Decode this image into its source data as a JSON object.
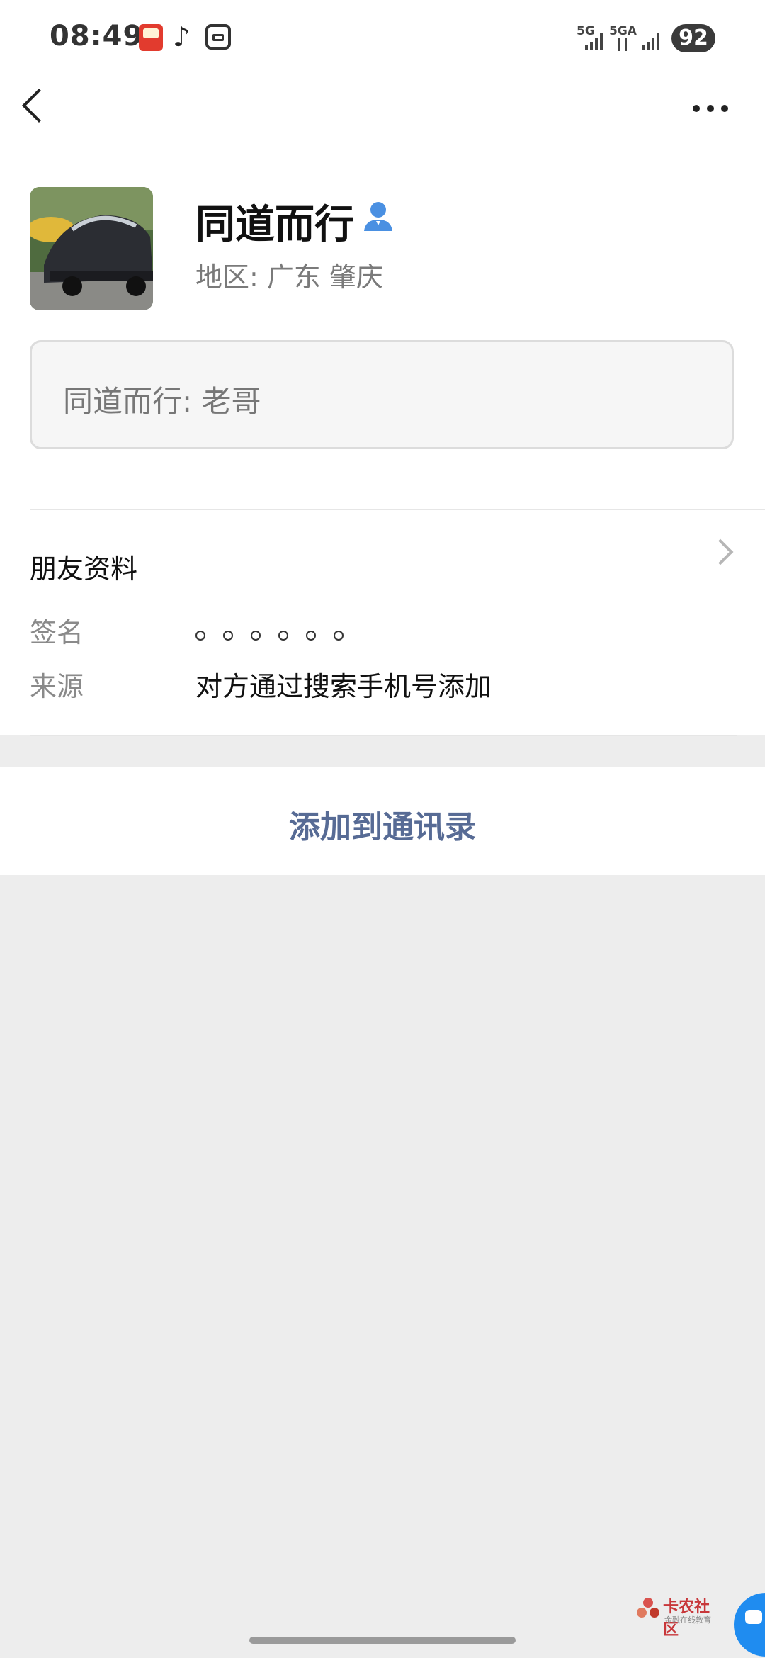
{
  "status_bar": {
    "time": "08:49",
    "net1": "5G",
    "net2": "5GA",
    "battery": "92",
    "icons": [
      "app-icon",
      "tiktok-icon",
      "screenshot-icon",
      "signal-icon",
      "signal-icon",
      "signal-icon",
      "battery-icon"
    ]
  },
  "nav": {
    "back_icon": "back-chevron",
    "more_icon": "more-dots"
  },
  "profile": {
    "nickname": "同道而行",
    "region": "地区:  广东  肇庆",
    "badge_icon": "person-icon",
    "badge_color": "#4a90e2"
  },
  "remark": {
    "text": "同道而行: 老哥"
  },
  "friend_info": {
    "title": "朋友资料",
    "signature_label": "签名",
    "signature_value": "。。。。。。",
    "source_label": "来源",
    "source_value": "对方通过搜索手机号添加"
  },
  "action": {
    "add_label": "添加到通讯录",
    "color": "#576b95"
  },
  "watermark": {
    "title": "卡农社区",
    "subtitle": "金融在线教育"
  }
}
